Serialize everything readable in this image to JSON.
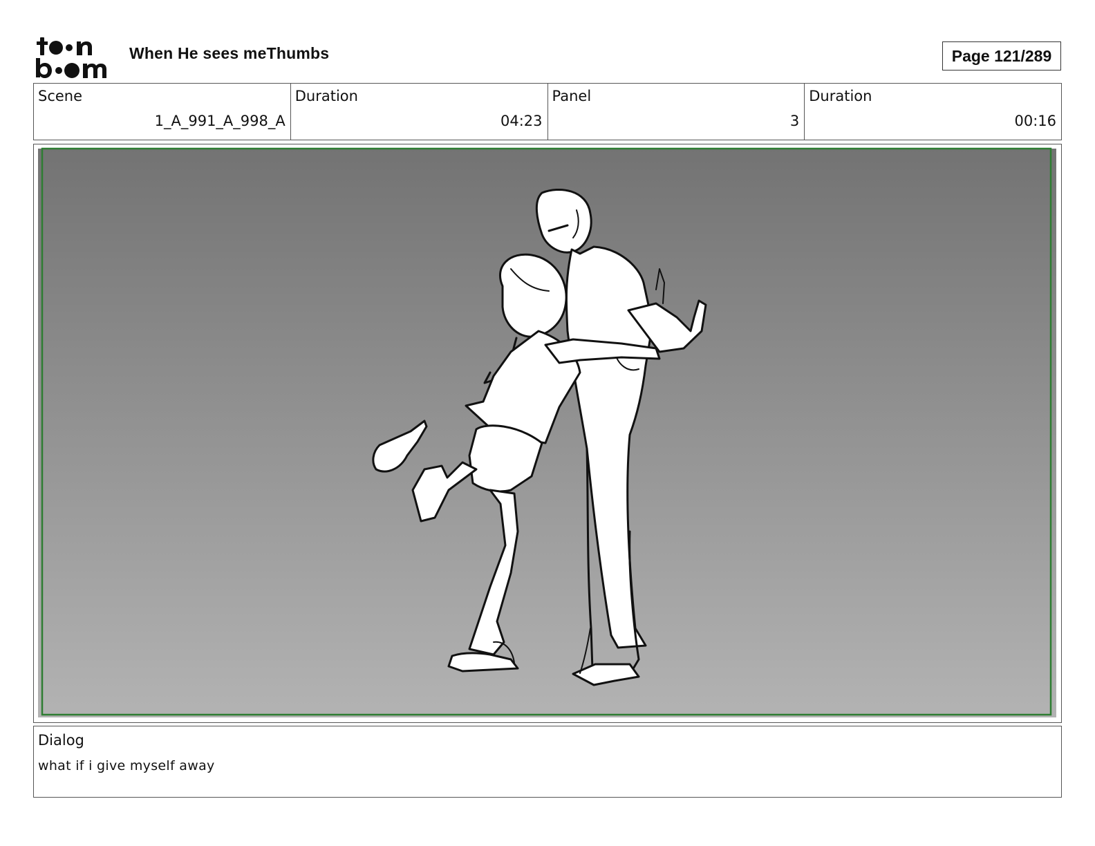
{
  "header": {
    "logo_text_top": "toon",
    "logo_text_bottom": "boom",
    "title": "When He sees meThumbs",
    "page": "Page 121/289"
  },
  "info": {
    "scene_label": "Scene",
    "scene_value": "1_A_991_A_998_A",
    "duration_label": "Duration",
    "duration_value": "04:23",
    "panel_label": "Panel",
    "panel_value": "3",
    "panel_duration_label": "Duration",
    "panel_duration_value": "00:16"
  },
  "panel": {
    "frame_color": "#2e7d32",
    "gradient_top": "#737373",
    "gradient_bottom": "#b3b3b3"
  },
  "dialog": {
    "label": "Dialog",
    "text": "what if i give myself away"
  }
}
